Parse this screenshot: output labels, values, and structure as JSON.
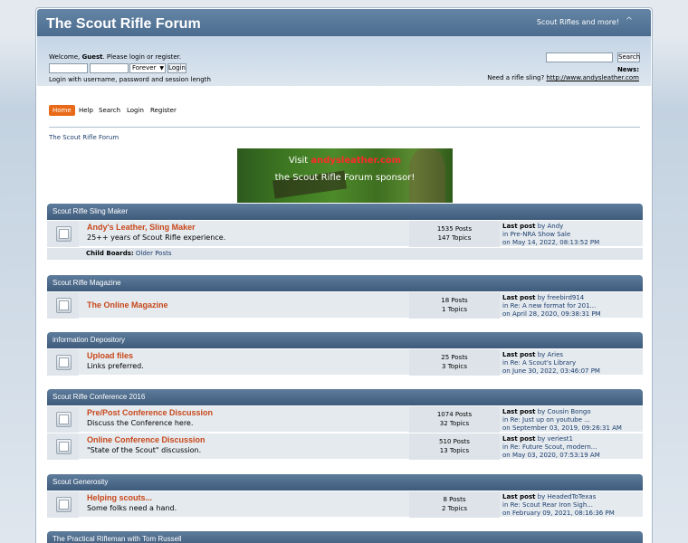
{
  "header": {
    "title": "The Scout Rifle Forum",
    "slogan": "Scout Rifles and more!",
    "collapse_glyph": "^"
  },
  "user": {
    "welcome_prefix": "Welcome, ",
    "guest": "Guest",
    "welcome_suffix": ". Please login or register.",
    "length_option": "Forever",
    "login_button": "Login",
    "login_hint": "Login with username, password and session length"
  },
  "search": {
    "button": "Search"
  },
  "news": {
    "title": "News:",
    "text": "Need a rifle sling? ",
    "link": "http://www.andysleather.com"
  },
  "menu": [
    "Home",
    "Help",
    "Search",
    "Login",
    "Register"
  ],
  "linktree": "The Scout Rifle Forum",
  "banner": {
    "line1_prefix": "Visit ",
    "line1_link": "andysleather.com",
    "line2": "the Scout Rifle Forum sponsor!"
  },
  "categories": [
    {
      "title": "Scout Rifle Sling Maker",
      "boards": [
        {
          "name": "Andy's Leather, Sling Maker",
          "desc": "25++ years of Scout Rifle experience.",
          "posts": "1535 Posts",
          "topics": "147 Topics",
          "last_label": "Last post",
          "last_by": "by Andy",
          "last_in": "in Pre-NRA Show Sale",
          "last_on": "on May 14, 2022, 08:13:52 PM"
        }
      ],
      "child_label": "Child Boards:",
      "child_boards": "Older Posts"
    },
    {
      "title": "Scout Rifle Magazine",
      "boards": [
        {
          "name": "The Online Magazine",
          "desc": "",
          "posts": "18 Posts",
          "topics": "1 Topics",
          "last_label": "Last post",
          "last_by": "by freebird914",
          "last_in": "in Re: A new format for 201...",
          "last_on": "on April 28, 2020, 09:38:31 PM"
        }
      ]
    },
    {
      "title": "information Depository",
      "boards": [
        {
          "name": "Upload files",
          "desc": "Links preferred.",
          "posts": "25 Posts",
          "topics": "3 Topics",
          "last_label": "Last post",
          "last_by": "by Aries",
          "last_in": "in Re: A Scout's Library",
          "last_on": "on June 30, 2022, 03:46:07 PM"
        }
      ]
    },
    {
      "title": "Scout Rifle Conference 2016",
      "boards": [
        {
          "name": "Pre/Post Conference Discussion",
          "desc": "Discuss the Conference here.",
          "posts": "1074 Posts",
          "topics": "32 Topics",
          "last_label": "Last post",
          "last_by": "by Cousin Bongo",
          "last_in": "in Re: Just up on youtube ...",
          "last_on": "on September 03, 2019, 09:26:31 AM"
        },
        {
          "name": "Online Conference Discussion",
          "desc": "\"State of the Scout\" discussion.",
          "posts": "510 Posts",
          "topics": "13 Topics",
          "last_label": "Last post",
          "last_by": "by veriest1",
          "last_in": "in Re: Future Scout, modern...",
          "last_on": "on May 03, 2020, 07:53:19 AM"
        }
      ]
    },
    {
      "title": "Scout Generosity",
      "boards": [
        {
          "name": "Helping scouts...",
          "desc": "Some folks need a hand.",
          "posts": "8 Posts",
          "topics": "2 Topics",
          "last_label": "Last post",
          "last_by": "by HeadedToTexas",
          "last_in": "in Re: Scout Rear Iron Sigh...",
          "last_on": "on February 09, 2021, 08:16:36 PM"
        }
      ]
    },
    {
      "title": "The Practical Rifleman with Tom Russell",
      "boards": []
    }
  ]
}
